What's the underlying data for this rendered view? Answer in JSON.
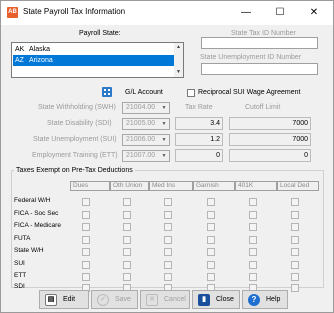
{
  "window": {
    "title": "State Payroll Tax Information",
    "icon_text": "AB",
    "minimize_glyph": "—",
    "maximize_glyph": "☐",
    "close_glyph": "✕"
  },
  "payroll_state": {
    "label": "Payroll State:",
    "items": [
      {
        "code": "AK",
        "name": "Alaska",
        "selected": false
      },
      {
        "code": "AZ",
        "name": "Arizona",
        "selected": true
      }
    ]
  },
  "state_tax_id": {
    "label": "State Tax ID Number",
    "value": ""
  },
  "state_unemployment_id": {
    "label": "State Unemployment ID Number",
    "value": ""
  },
  "gl_account": {
    "label": "G/L Account"
  },
  "reciprocal": {
    "label": "Reciprocal SUI Wage Agreement",
    "checked": false
  },
  "columns": {
    "tax_rate": "Tax Rate",
    "cutoff_limit": "Cutoff Limit"
  },
  "tax_rows": [
    {
      "label": "State Withholding (SWH)",
      "account": "21004.00",
      "rate": "",
      "cutoff": ""
    },
    {
      "label": "State Disability (SDI)",
      "account": "21005.00",
      "rate": "3.4",
      "cutoff": "7000"
    },
    {
      "label": "State Unemployment (SUI)",
      "account": "21006.00",
      "rate": "1.2",
      "cutoff": "7000"
    },
    {
      "label": "Employment Training (ETT)",
      "account": "21007.00",
      "rate": "0",
      "cutoff": "0"
    }
  ],
  "exempt": {
    "title": "Taxes Exempt on Pre-Tax Deductions",
    "columns": [
      "Dues",
      "Oth Union",
      "Med Ins",
      "Garnish",
      "401K",
      "Local Ded"
    ],
    "rows": [
      {
        "label": "Federal W/H",
        "checks": [
          false,
          false,
          false,
          false,
          false,
          false
        ]
      },
      {
        "label": "FICA - Soc Sec",
        "checks": [
          false,
          false,
          false,
          false,
          false,
          false
        ]
      },
      {
        "label": "FICA - Medicare",
        "checks": [
          false,
          false,
          false,
          false,
          false,
          false
        ]
      },
      {
        "label": "FUTA",
        "checks": [
          false,
          false,
          false,
          false,
          false,
          false
        ]
      },
      {
        "label": "State W/H",
        "checks": [
          false,
          false,
          false,
          false,
          false,
          false
        ]
      },
      {
        "label": "SUI",
        "checks": [
          false,
          false,
          false,
          false,
          false,
          false
        ]
      },
      {
        "label": "ETT",
        "checks": [
          false,
          false,
          false,
          false,
          false,
          false
        ]
      },
      {
        "label": "SDI",
        "checks": [
          false,
          false,
          false,
          false,
          false,
          false
        ]
      }
    ]
  },
  "buttons": {
    "edit": "Edit",
    "save": "Save",
    "cancel": "Cancel",
    "close": "Close",
    "help": "Help"
  },
  "colors": {
    "selection": "#0078d7",
    "title_icon": "#e8602b",
    "close_icon": "#1a4f9c",
    "help_icon": "#1f6fd1"
  }
}
